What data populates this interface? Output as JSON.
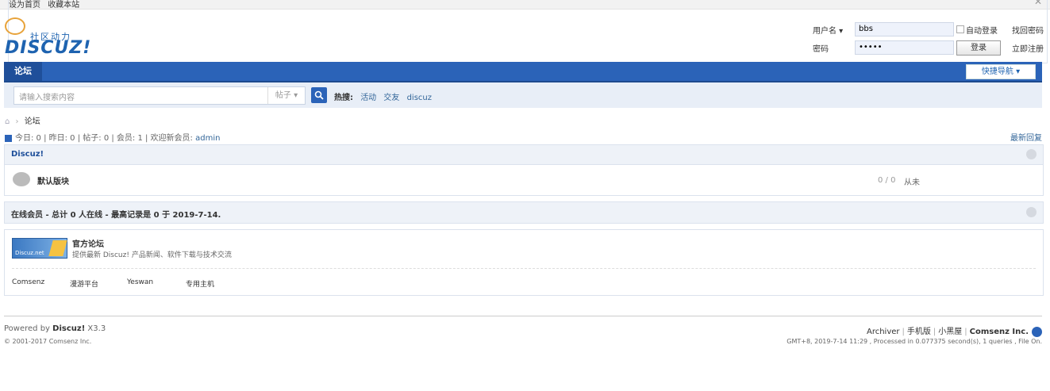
{
  "topbar": {
    "link1": "设为首页",
    "link2": "收藏本站",
    "close": "✕"
  },
  "logo": {
    "tagline": "社区动力",
    "brand": "DISCUZ!"
  },
  "login": {
    "username_label": "用户名 ▾",
    "username_value": "bbs",
    "password_label": "密码",
    "password_value": "•••••",
    "autologin_label": "自动登录",
    "forgot_label": "找回密码",
    "login_button": "登录",
    "register_label": "立即注册"
  },
  "nav": {
    "item": "论坛",
    "quick": "快捷导航 ▾"
  },
  "search": {
    "placeholder": "请输入搜索内容",
    "type": "帖子 ▾",
    "button_icon": "search-icon",
    "hot_label": "热搜:",
    "hot_terms": [
      "活动",
      "交友",
      "discuz"
    ]
  },
  "breadcrumb": {
    "home_icon": "home-icon",
    "sep": "›",
    "current": "论坛"
  },
  "stats": {
    "text": "今日: 0 | 昨日: 0 | 帖子: 0 | 会员: 1 | 欢迎新会员: ",
    "newest_member": "admin",
    "new_reply": "最新回复"
  },
  "forum_group": {
    "title": "Discuz!",
    "forum_name": "默认版块",
    "counts": "0 / 0",
    "last_post": "从未"
  },
  "online": {
    "title": "在线会员 - 总计 0 人在线 - 最高记录是 0 于 2019-7-14."
  },
  "friend_links": {
    "banner_text": "Discuz.net",
    "title": "官方论坛",
    "desc": "提供最新 Discuz! 产品新闻、软件下载与技术交流",
    "items": [
      "Comsenz",
      "漫游平台",
      "Yeswan",
      "专用主机"
    ]
  },
  "footer": {
    "powered": "Powered by ",
    "brand": "Discuz!",
    "version": " X3.3",
    "copyright": "© 2001-2017 Comsenz Inc.",
    "links": [
      "Archiver",
      "手机版",
      "小黑屋"
    ],
    "company": "Comsenz Inc.",
    "info": "GMT+8, 2019-7-14 11:29 , Processed in 0.077375 second(s), 1 queries , File On."
  },
  "colors": {
    "accent": "#2b63b8",
    "brand": "#1e63b0"
  }
}
